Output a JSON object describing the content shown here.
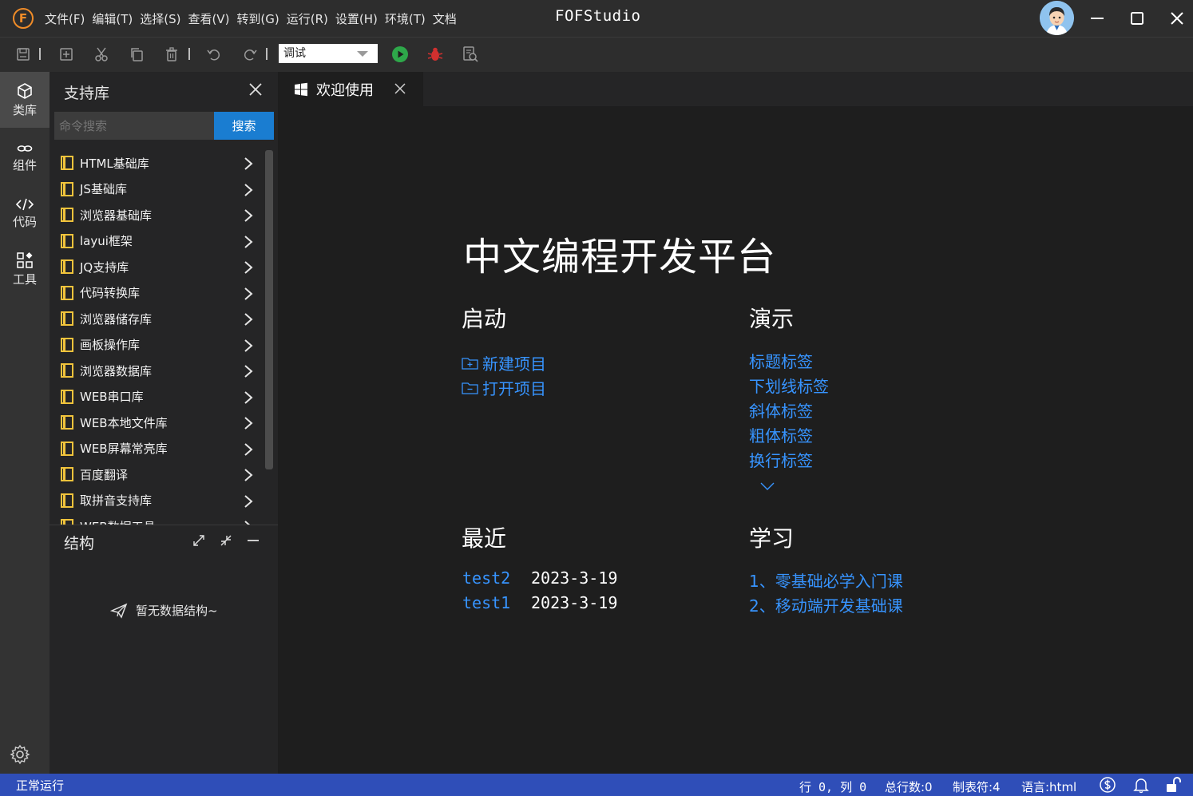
{
  "titlebar": {
    "logo_letter": "F",
    "menus": [
      "文件(F)",
      "编辑(T)",
      "选择(S)",
      "查看(V)",
      "转到(G)",
      "运行(R)",
      "设置(H)",
      "环境(T)",
      "文档"
    ],
    "app_title": "FOFStudio"
  },
  "toolbar": {
    "mode": "调试",
    "icons": [
      "save-icon",
      "new-file-icon",
      "cut-icon",
      "copy-icon",
      "delete-icon",
      "undo-icon",
      "redo-icon",
      "run-icon",
      "debug-icon",
      "search-file-icon"
    ]
  },
  "activity": {
    "items": [
      {
        "label": "类库",
        "icon": "cube-icon"
      },
      {
        "label": "组件",
        "icon": "link-icon"
      },
      {
        "label": "代码",
        "icon": "code-icon"
      },
      {
        "label": "工具",
        "icon": "grid-icon"
      }
    ],
    "settings_icon": "gear-icon"
  },
  "library": {
    "title": "支持库",
    "search_placeholder": "命令搜索",
    "search_button": "搜索",
    "items": [
      "HTML基础库",
      "JS基础库",
      "浏览器基础库",
      "layui框架",
      "JQ支持库",
      "代码转换库",
      "浏览器储存库",
      "画板操作库",
      "浏览器数据库",
      "WEB串口库",
      "WEB本地文件库",
      "WEB屏幕常亮库",
      "百度翻译",
      "取拼音支持库",
      "WEB数据工具"
    ]
  },
  "structure": {
    "title": "结构",
    "empty_text": "暂无数据结构~"
  },
  "tab": {
    "label": "欢迎使用"
  },
  "welcome": {
    "title": "中文编程开发平台",
    "start": {
      "title": "启动",
      "links": [
        "新建项目",
        "打开项目"
      ]
    },
    "demo": {
      "title": "演示",
      "links": [
        "标题标签",
        "下划线标签",
        "斜体标签",
        "粗体标签",
        "换行标签"
      ]
    },
    "recent": {
      "title": "最近",
      "items": [
        {
          "name": "test2",
          "date": "2023-3-19"
        },
        {
          "name": "test1",
          "date": "2023-3-19"
        }
      ]
    },
    "learn": {
      "title": "学习",
      "links": [
        "1、零基础必学入门课",
        "2、移动端开发基础课"
      ]
    }
  },
  "status": {
    "state": "正常运行",
    "position": "行 0, 列 0",
    "total_lines": "总行数:0",
    "tab_size": "制表符:4",
    "language": "语言:html"
  },
  "colors": {
    "accent": "#1a7dd1",
    "link": "#3794ff",
    "statusbar": "#2f4eb8",
    "lib_icon": "#f0c33c",
    "logo": "#f08c28"
  }
}
